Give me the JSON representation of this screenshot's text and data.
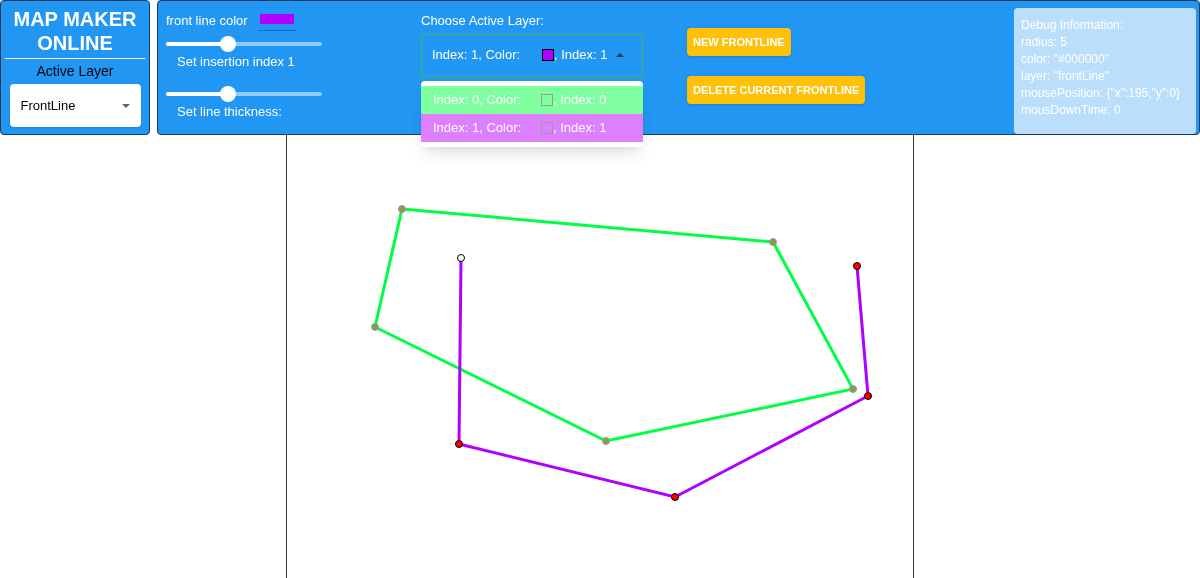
{
  "brand": {
    "title": "MAP MAKER ONLINE",
    "subtitle": "Active Layer"
  },
  "layer_select": {
    "value": "FrontLine"
  },
  "front_line_color": {
    "label": "front line color",
    "color": "#b000ff"
  },
  "sliders": [
    {
      "label": "Set insertion index 1",
      "level": 0.4
    },
    {
      "label": "Set line thickness:",
      "level": 0.4
    }
  ],
  "active_layer": {
    "label": "Choose Active Layer:",
    "value_prefix": "Index: 1, Color:",
    "value_suffix": ", Index: 1",
    "color": "#b000ff",
    "expanded": true,
    "options": [
      {
        "prefix": "Index: 0, Color:",
        "suffix": ", Index: 0",
        "color": "#80ffa0"
      },
      {
        "prefix": "Index: 1, Color:",
        "suffix": ", Index: 1",
        "color": "#dd80ff"
      }
    ]
  },
  "buttons": [
    "NEW FRONTLINE",
    "DELETE CURRENT FRONTLINE"
  ],
  "debug": {
    "title": "Debug Information:",
    "lines": [
      "radius: 5",
      "color: \"#000000\"",
      "layer: \"frontLine\"",
      "mousePosition: {\"x\":195,\"y\":0}",
      "mousDownTime: 0"
    ]
  },
  "frontlines": [
    {
      "color": "#00ff44",
      "closed": true
    },
    {
      "color": "#b000ff",
      "closed": false
    }
  ]
}
